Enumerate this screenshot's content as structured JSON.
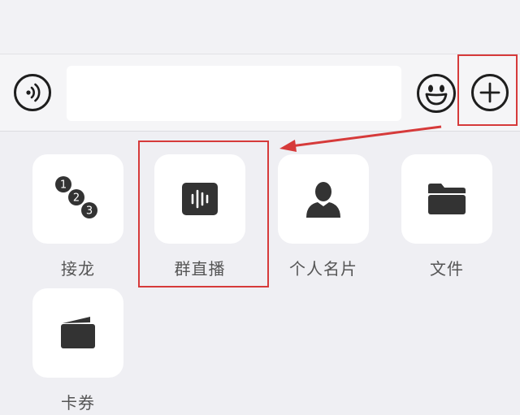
{
  "input_bar": {
    "voice_icon": "voice-wave-icon",
    "text_input_value": "",
    "emoji_icon": "smiley-face-icon",
    "plus_icon": "plus-circle-icon"
  },
  "panel": {
    "items": [
      {
        "label": "接龙",
        "icon": "numbered-circles-icon"
      },
      {
        "label": "群直播",
        "icon": "live-waveform-icon"
      },
      {
        "label": "个人名片",
        "icon": "person-silhouette-icon"
      },
      {
        "label": "文件",
        "icon": "folder-icon"
      },
      {
        "label": "卡券",
        "icon": "wallet-card-icon"
      }
    ]
  },
  "colors": {
    "highlight": "#d63a3a",
    "icon": "#333333",
    "background": "#efeff3"
  }
}
